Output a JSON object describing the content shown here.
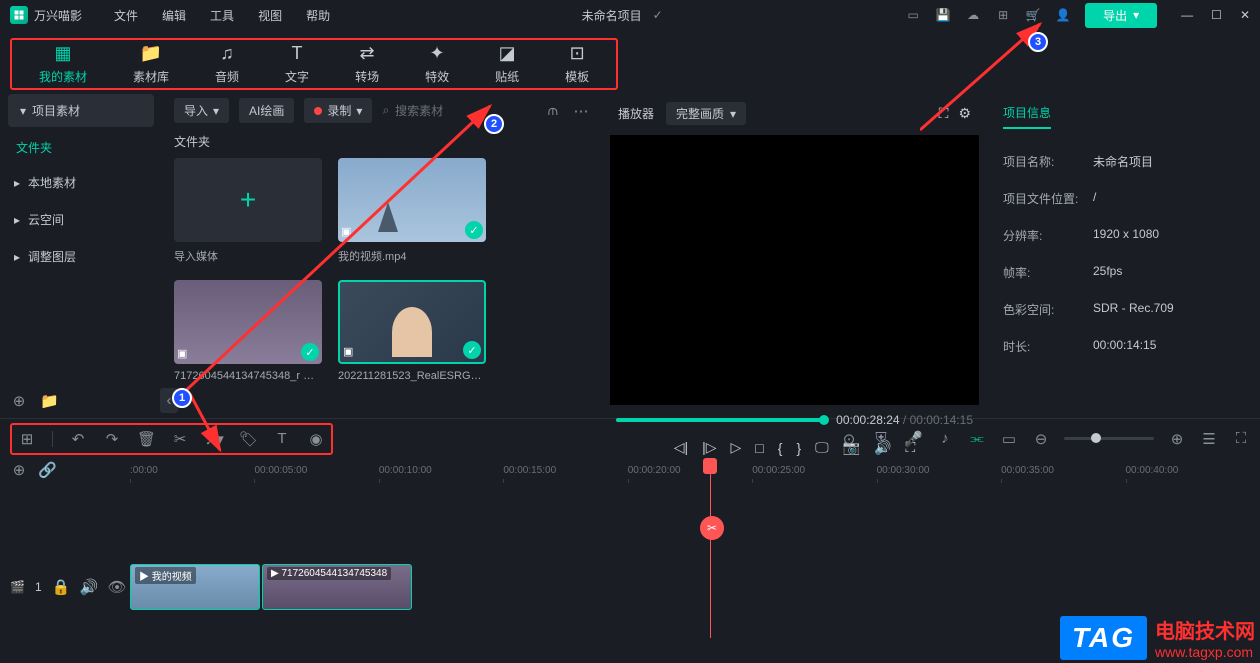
{
  "app": {
    "name": "万兴喵影",
    "project_title": "未命名项目"
  },
  "menubar": [
    "文件",
    "编辑",
    "工具",
    "视图",
    "帮助"
  ],
  "export_label": "导出",
  "tabs": [
    {
      "label": "我的素材"
    },
    {
      "label": "素材库"
    },
    {
      "label": "音频"
    },
    {
      "label": "文字"
    },
    {
      "label": "转场"
    },
    {
      "label": "特效"
    },
    {
      "label": "贴纸"
    },
    {
      "label": "模板"
    }
  ],
  "sidebar": {
    "header": "项目素材",
    "file_label": "文件夹",
    "items": [
      "本地素材",
      "云空间",
      "调整图层"
    ]
  },
  "media": {
    "import_label": "导入",
    "ai_label": "AI绘画",
    "record_label": "录制",
    "search_placeholder": "搜索素材",
    "folder_label": "文件夹",
    "items": [
      {
        "label": "导入媒体"
      },
      {
        "label": "我的视频.mp4"
      },
      {
        "label": "7172604544134745348_r …"
      },
      {
        "label": "202211281523_RealESRG…"
      }
    ]
  },
  "player": {
    "title": "播放器",
    "quality": "完整画质",
    "current_time": "00:00:28:24",
    "duration": "00:00:14:15"
  },
  "info": {
    "tab_label": "项目信息",
    "rows": [
      {
        "label": "项目名称:",
        "value": "未命名项目"
      },
      {
        "label": "项目文件位置:",
        "value": "/"
      },
      {
        "label": "分辨率:",
        "value": "1920 x 1080"
      },
      {
        "label": "帧率:",
        "value": "25fps"
      },
      {
        "label": "色彩空间:",
        "value": "SDR - Rec.709"
      },
      {
        "label": "时长:",
        "value": "00:00:14:15"
      }
    ]
  },
  "timeline": {
    "ticks": [
      ":00:00",
      "00:00:05:00",
      "00:00:10:00",
      "00:00:15:00",
      "00:00:20:00",
      "00:00:25:00",
      "00:00:30:00",
      "00:00:35:00",
      "00:00:40:00"
    ],
    "track_num": "1",
    "clips": [
      {
        "label": "我的视频"
      },
      {
        "label": "7172604544134745348"
      }
    ]
  },
  "watermark": {
    "tag": "TAG",
    "text": "电脑技术网",
    "url": "www.tagxp.com"
  }
}
